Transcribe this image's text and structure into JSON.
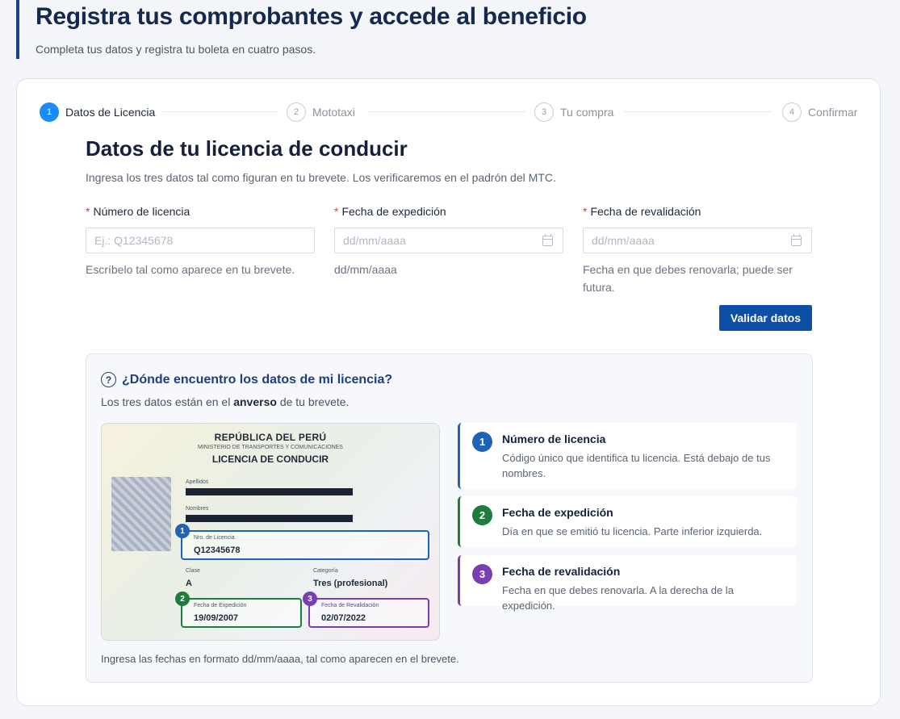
{
  "header": {
    "title": "Registra tus comprobantes y accede al beneficio",
    "subtitle": "Completa tus datos y registra tu boleta en cuatro pasos."
  },
  "steps": [
    {
      "number": "1",
      "label": "Datos de Licencia",
      "active": true
    },
    {
      "number": "2",
      "label": "Mototaxi",
      "active": false
    },
    {
      "number": "3",
      "label": "Tu compra",
      "active": false
    },
    {
      "number": "4",
      "label": "Confirmar",
      "active": false
    }
  ],
  "form": {
    "title": "Datos de tu licencia de conducir",
    "description": "Ingresa los tres datos tal como figuran en tu brevete. Los verificaremos en el padrón del MTC.",
    "required_mark": "*",
    "fields": [
      {
        "label": "Número de licencia",
        "placeholder": "Ej.: Q12345678",
        "value": "",
        "help": "Escríbelo tal como aparece en tu brevete."
      },
      {
        "label": "Fecha de expedición",
        "placeholder": "dd/mm/aaaa",
        "value": "",
        "help": "dd/mm/aaaa",
        "icon": "calendar-icon"
      },
      {
        "label": "Fecha de revalidación",
        "placeholder": "dd/mm/aaaa",
        "value": "",
        "help": "Fecha en que debes renovarla; puede ser futura.",
        "icon": "calendar-icon"
      }
    ],
    "submit_label": "Validar datos"
  },
  "help": {
    "icon": "question-icon",
    "icon_glyph": "?",
    "title": "¿Dónde encuentro los datos de mi licencia?",
    "subtitle_pre": "Los tres datos están en el",
    "subtitle_bold": "anverso",
    "subtitle_post": "de tu brevete.",
    "license_card": {
      "line1": "REPÚBLICA DEL PERÚ",
      "line2": "MINISTERIO DE TRANSPORTES Y COMUNICACIONES",
      "line3": "LICENCIA DE CONDUCIR",
      "apellidos_label": "Apellidos",
      "nombres_label": "Nombres",
      "license_no_label": "Nro. de Licencia",
      "license_no": "Q12345678",
      "clase_label": "Clase",
      "clase": "A",
      "categoria_label": "Categoría",
      "categoria": "Tres (profesional)",
      "expedicion_label": "Fecha de Expedición",
      "expedicion": "19/09/2007",
      "revalidacion_label": "Fecha de Revalidación",
      "revalidacion": "02/07/2022"
    },
    "items": [
      {
        "number": "1",
        "title": "Número de licencia",
        "description": "Código único que identifica tu licencia. Está debajo de tus nombres.",
        "color": "#1e63b5"
      },
      {
        "number": "2",
        "title": "Fecha de expedición",
        "description": "Día en que se emitió tu licencia. Parte inferior izquierda.",
        "color": "#1e7d3b"
      },
      {
        "number": "3",
        "title": "Fecha de revalidación",
        "description": "Fecha en que debes renovarla. A la derecha de la expedición.",
        "color": "#7a3eb3"
      }
    ],
    "footer": "Ingresa las fechas en formato dd/mm/aaaa, tal como aparecen en el brevete."
  }
}
